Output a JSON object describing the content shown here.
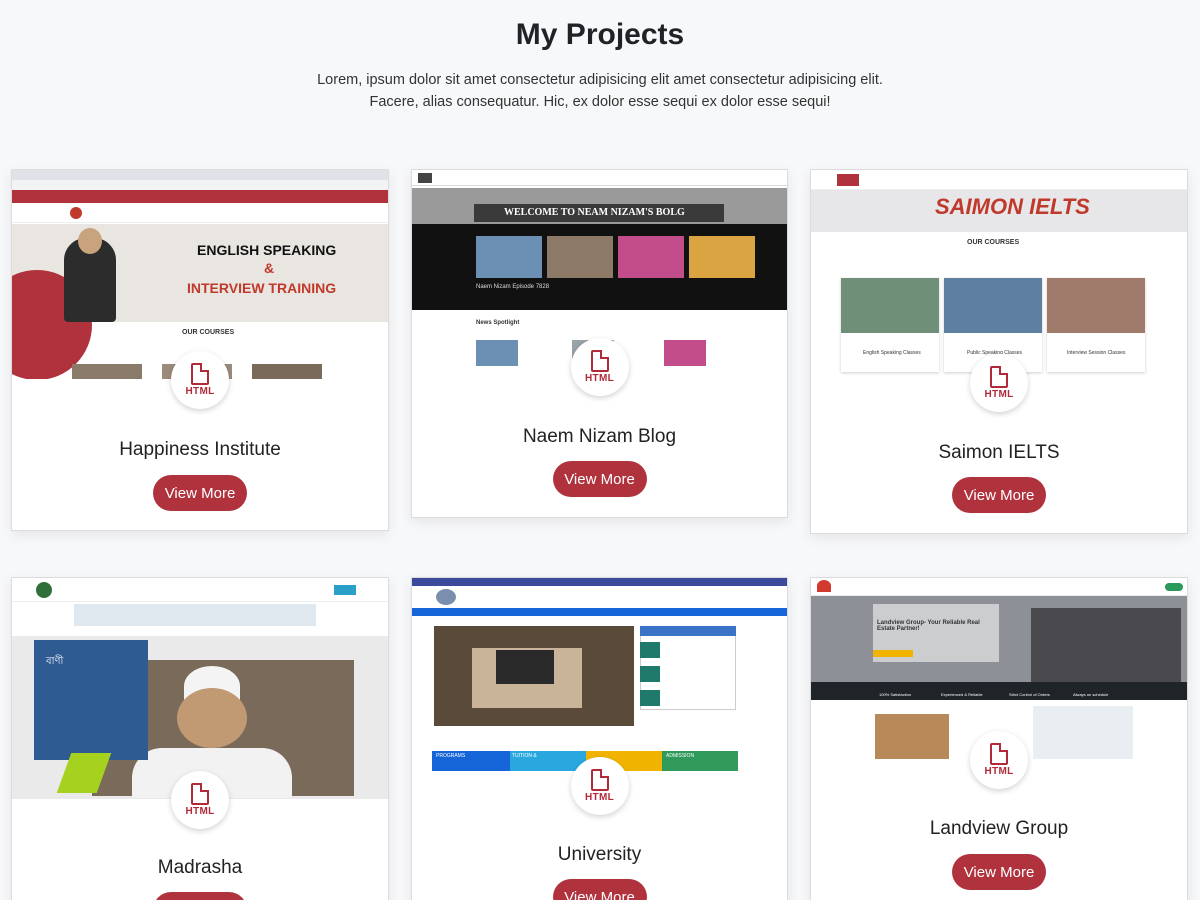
{
  "header": {
    "title": "My Projects",
    "subtitle_line1": "Lorem, ipsum dolor sit amet consectetur adipisicing elit amet consectetur adipisicing elit.",
    "subtitle_line2": "Facere, alias consequatur. Hic, ex dolor esse sequi ex dolor esse sequi!"
  },
  "badge_label": "HTML",
  "button_label": "View More",
  "projects": [
    {
      "title": "Happiness Institute",
      "thumb": {
        "banner_line1": "ENGLISH SPEAKING",
        "banner_line2": "&",
        "banner_line3": "INTERVIEW TRAINING",
        "section": "OUR COURSES"
      }
    },
    {
      "title": "Naem Nizam Blog",
      "thumb": {
        "banner": "WELCOME TO NEAM NIZAM'S BOLG",
        "episode": "Naem Nizam Episode 7828",
        "section": "News Spotlight"
      }
    },
    {
      "title": "Saimon IELTS",
      "thumb": {
        "logo": "SAIMON IELTS",
        "section": "OUR COURSES",
        "course1": "English Speaking Classes",
        "course2": "Public Speaking Classes",
        "course3": "Interview Session Classes"
      }
    },
    {
      "title": "Madrasha",
      "thumb": {
        "quote_title": "বাণী"
      }
    },
    {
      "title": "University",
      "thumb": {
        "tile1": "PROGRAMS",
        "tile2": "TUITION &",
        "tile4": "ADMISSION"
      }
    },
    {
      "title": "Landview Group",
      "thumb": {
        "hero": "Landview Group- Your Reliable Real Estate Partner!",
        "feature1": "100% Satisfaction",
        "feature2": "Experienced & Reliable",
        "feature3": "Strict Control of Orders",
        "feature4": "Always on schedule"
      }
    }
  ],
  "colors": {
    "accent": "#b0323d",
    "background": "#f7f8fa"
  }
}
